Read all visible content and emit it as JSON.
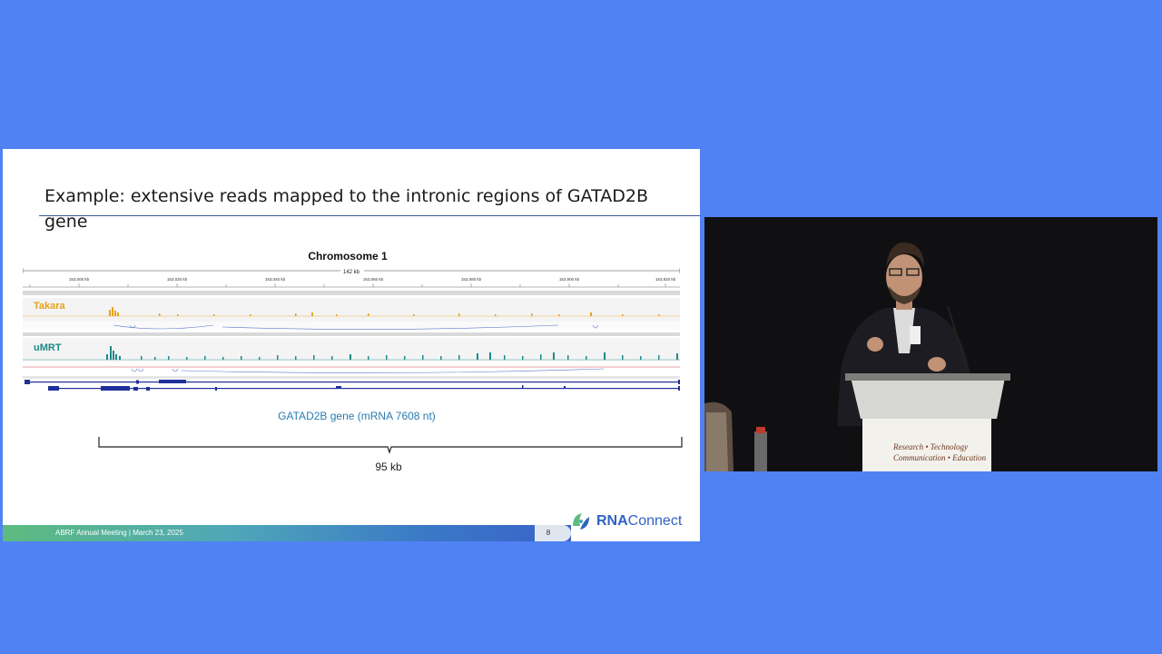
{
  "slide": {
    "title": "Example: extensive reads mapped to the intronic regions of GATAD2B gene",
    "chromosome_title": "Chromosome 1",
    "scale_label": "142 kb",
    "coordinates": [
      "153,000 kb",
      "153,020 kb",
      "153,040 kb",
      "153,060 kb",
      "153,080 kb",
      "153,900 kb",
      "153,920 kb"
    ],
    "tracks": [
      {
        "label": "Takara",
        "color": "#e9a11b"
      },
      {
        "label": "uMRT",
        "color": "#1d8a8a"
      }
    ],
    "gene_label": "GATAD2B gene (mRNA 7608 nt)",
    "span_label": "95 kb",
    "footer_text": "ABRF Annual Meeting | March 23, 2025",
    "slide_number": "8",
    "logo": {
      "part1": "RNA",
      "part2": "Connect"
    }
  },
  "video": {
    "sign_line1": "Research • Technology",
    "sign_line2": "Communication • Education"
  },
  "colors": {
    "background": "#5082f4",
    "takara_track": "#e9a11b",
    "umrt_track": "#1d8a8a",
    "gene_text": "#2a7bb0",
    "logo_blue": "#2f62c6"
  }
}
